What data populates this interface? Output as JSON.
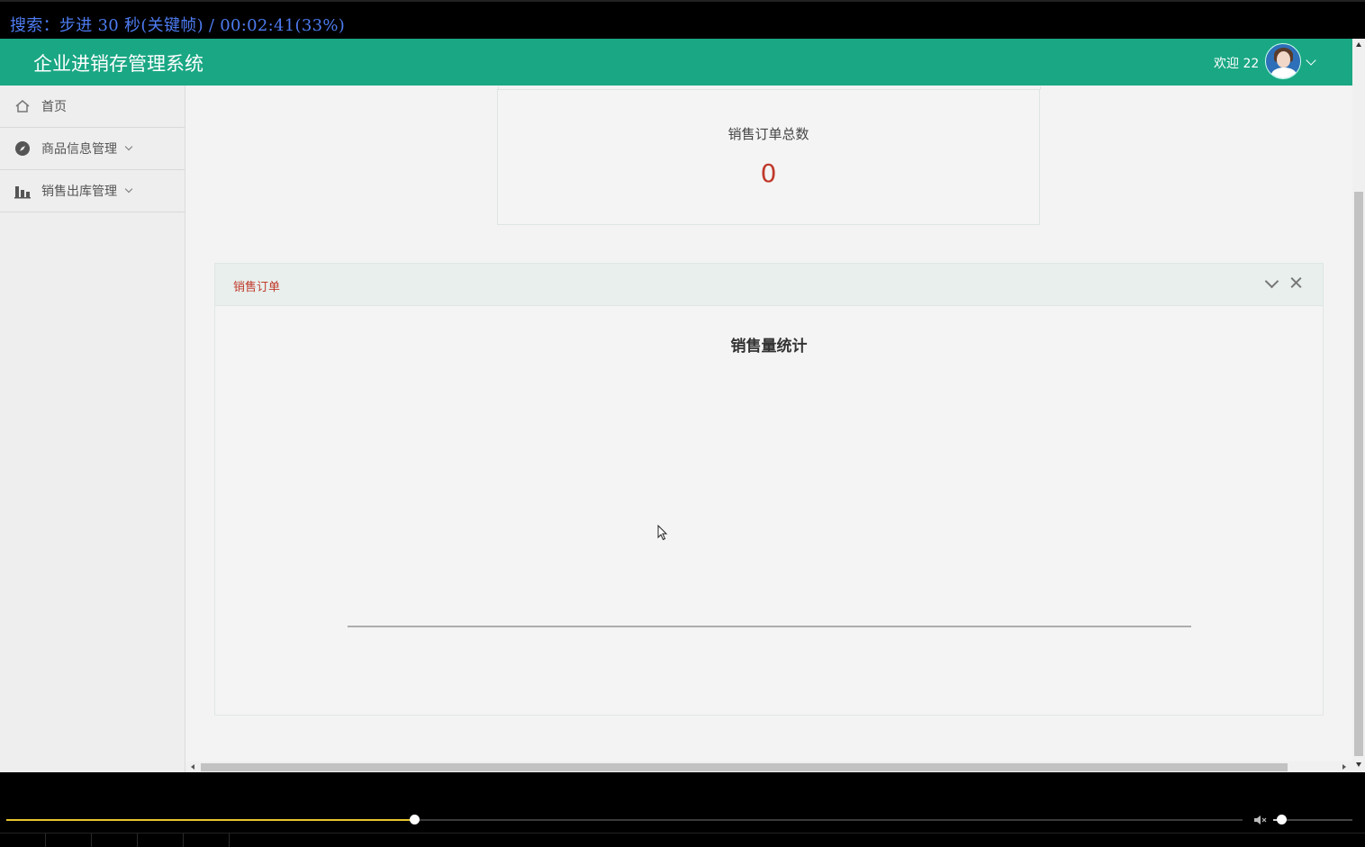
{
  "osd": {
    "text": "搜索：步进 30 秒(关键帧) / 00:02:41(33%)"
  },
  "header": {
    "title": "企业进销存管理系统",
    "welcome": "欢迎 22",
    "accent_color": "#1aa784"
  },
  "sidebar": {
    "items": [
      {
        "label": "首页",
        "icon": "home-icon"
      },
      {
        "label": "商品信息管理",
        "icon": "compass-icon"
      },
      {
        "label": "销售出库管理",
        "icon": "bar-chart-icon"
      }
    ]
  },
  "stat": {
    "label": "销售订单总数",
    "value": "0"
  },
  "panel": {
    "title": "销售订单"
  },
  "chart_data": {
    "type": "bar",
    "title": "销售量统计",
    "categories": [],
    "values": []
  },
  "player": {
    "progress_percent": 33,
    "volume_percent": 10
  }
}
